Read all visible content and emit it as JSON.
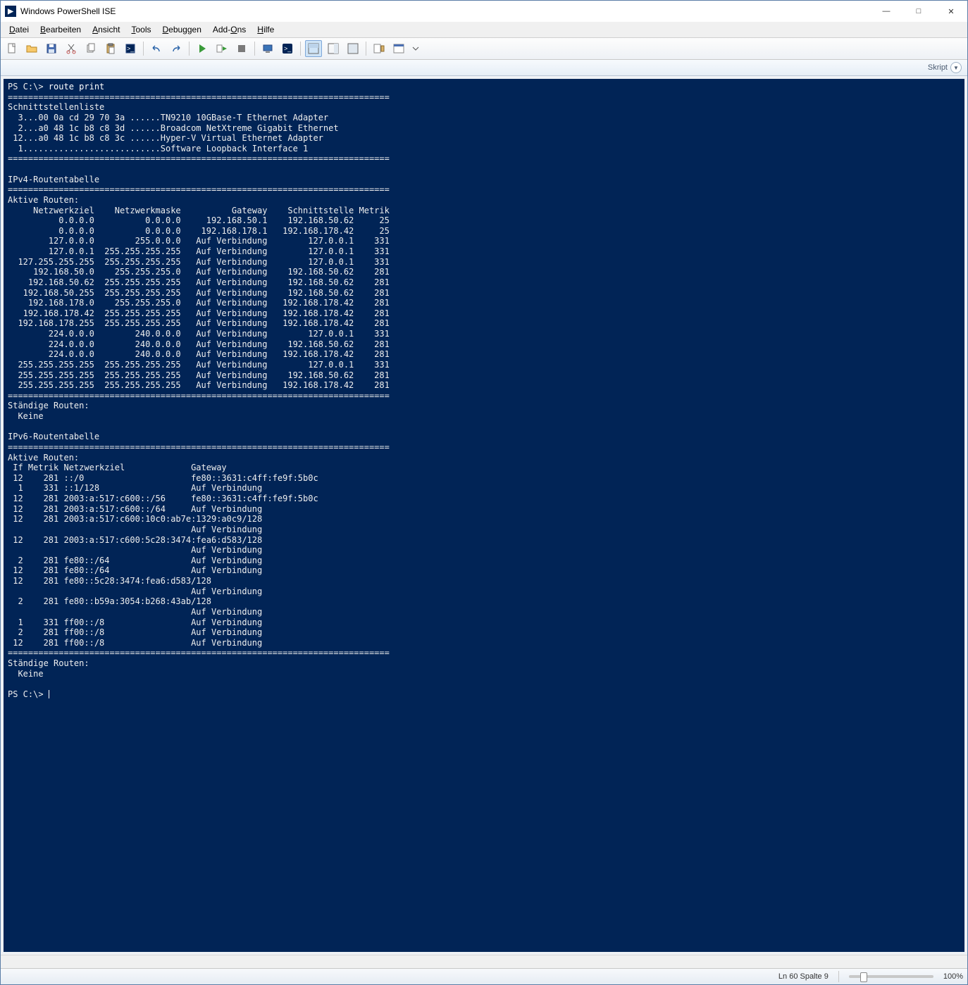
{
  "title": "Windows PowerShell ISE",
  "menu": [
    "Datei",
    "Bearbeiten",
    "Ansicht",
    "Tools",
    "Debuggen",
    "Add-Ons",
    "Hilfe"
  ],
  "tabrow": {
    "label": "Skript"
  },
  "statusbar": {
    "pos": "Ln 60  Spalte 9",
    "zoom": "100%"
  },
  "console": {
    "prompt1": "PS C:\\> ",
    "cmd": "route print",
    "prompt2": "PS C:\\> ",
    "output": "===========================================================================\nSchnittstellenliste\n  3...00 0a cd 29 70 3a ......TN9210 10GBase-T Ethernet Adapter\n  2...a0 48 1c b8 c8 3d ......Broadcom NetXtreme Gigabit Ethernet\n 12...a0 48 1c b8 c8 3c ......Hyper-V Virtual Ethernet Adapter\n  1...........................Software Loopback Interface 1\n===========================================================================\n\nIPv4-Routentabelle\n===========================================================================\nAktive Routen:\n     Netzwerkziel    Netzwerkmaske          Gateway    Schnittstelle Metrik\n          0.0.0.0          0.0.0.0     192.168.50.1    192.168.50.62     25\n          0.0.0.0          0.0.0.0    192.168.178.1   192.168.178.42     25\n        127.0.0.0        255.0.0.0   Auf Verbindung        127.0.0.1    331\n        127.0.0.1  255.255.255.255   Auf Verbindung        127.0.0.1    331\n  127.255.255.255  255.255.255.255   Auf Verbindung        127.0.0.1    331\n     192.168.50.0    255.255.255.0   Auf Verbindung    192.168.50.62    281\n    192.168.50.62  255.255.255.255   Auf Verbindung    192.168.50.62    281\n   192.168.50.255  255.255.255.255   Auf Verbindung    192.168.50.62    281\n    192.168.178.0    255.255.255.0   Auf Verbindung   192.168.178.42    281\n   192.168.178.42  255.255.255.255   Auf Verbindung   192.168.178.42    281\n  192.168.178.255  255.255.255.255   Auf Verbindung   192.168.178.42    281\n        224.0.0.0        240.0.0.0   Auf Verbindung        127.0.0.1    331\n        224.0.0.0        240.0.0.0   Auf Verbindung    192.168.50.62    281\n        224.0.0.0        240.0.0.0   Auf Verbindung   192.168.178.42    281\n  255.255.255.255  255.255.255.255   Auf Verbindung        127.0.0.1    331\n  255.255.255.255  255.255.255.255   Auf Verbindung    192.168.50.62    281\n  255.255.255.255  255.255.255.255   Auf Verbindung   192.168.178.42    281\n===========================================================================\nSt\u001fndige Routen:\n  Keine\n\nIPv6-Routentabelle\n===========================================================================\nAktive Routen:\n If Metrik Netzwerkziel             Gateway\n 12    281 ::/0                     fe80::3631:c4ff:fe9f:5b0c\n  1    331 ::1/128                  Auf Verbindung\n 12    281 2003:a:517:c600::/56     fe80::3631:c4ff:fe9f:5b0c\n 12    281 2003:a:517:c600::/64     Auf Verbindung\n 12    281 2003:a:517:c600:10c0:ab7e:1329:a0c9/128\n                                    Auf Verbindung\n 12    281 2003:a:517:c600:5c28:3474:fea6:d583/128\n                                    Auf Verbindung\n  2    281 fe80::/64                Auf Verbindung\n 12    281 fe80::/64                Auf Verbindung\n 12    281 fe80::5c28:3474:fea6:d583/128\n                                    Auf Verbindung\n  2    281 fe80::b59a:3054:b268:43ab/128\n                                    Auf Verbindung\n  1    331 ff00::/8                 Auf Verbindung\n  2    281 ff00::/8                 Auf Verbindung\n 12    281 ff00::/8                 Auf Verbindung\n===========================================================================\nSt\u001fndige Routen:\n  Keine\n"
  },
  "toolbar_icons": [
    "new-file",
    "open-file",
    "save-file",
    "cut",
    "copy",
    "paste",
    "clipboard-paste",
    "sep",
    "undo",
    "redo",
    "sep",
    "run-script",
    "run-selection",
    "stop",
    "sep",
    "breakpoint",
    "open-console",
    "sep",
    "layout-full",
    "layout-right",
    "layout-bottom",
    "sep",
    "commands-addon",
    "commands-window",
    "options-dropdown"
  ]
}
